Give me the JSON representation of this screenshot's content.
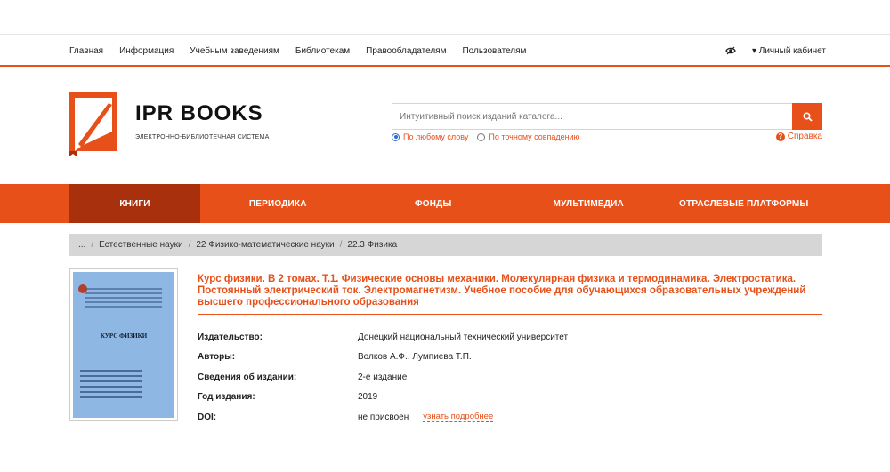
{
  "topnav": {
    "items": [
      "Главная",
      "Информация",
      "Учебным заведениям",
      "Библиотекам",
      "Правообладателям",
      "Пользователям"
    ],
    "account": "▾ Личный кабинет"
  },
  "brand": {
    "name": "IPR BOOKS",
    "tagline": "ЭЛЕКТРОННО-БИБЛИОТЕЧНАЯ СИСТЕМА"
  },
  "search": {
    "placeholder": "Интуитивный поиск изданий каталога...",
    "option_any": "По любому слову",
    "option_exact": "По точному совпадению",
    "help": "Справка"
  },
  "mainnav": [
    "КНИГИ",
    "ПЕРИОДИКА",
    "ФОНДЫ",
    "МУЛЬТИМЕДИА",
    "ОТРАСЛЕВЫЕ ПЛАТФОРМЫ"
  ],
  "breadcrumb": [
    "...",
    "Естественные науки",
    "22 Физико-математические науки",
    "22.3 Физика"
  ],
  "book": {
    "title": "Курс физики. В 2 томах. Т.1. Физические основы механики. Молекулярная физика и термодинамика. Электростатика. Постоянный электрический ток. Электромагнетизм. Учебное пособие для обучающихся образовательных учреждений высшего профессионального образования",
    "cover_title": "КУРС ФИЗИКИ",
    "fields": [
      {
        "label": "Издательство:",
        "value": "Донецкий национальный технический университет"
      },
      {
        "label": "Авторы:",
        "value": "Волков А.Ф., Лумпиева Т.П."
      },
      {
        "label": "Сведения об издании:",
        "value": "2-е издание"
      },
      {
        "label": "Год издания:",
        "value": "2019"
      },
      {
        "label": "DOI:",
        "value": "не присвоен"
      }
    ],
    "doi_link": "узнать подробнее"
  },
  "colors": {
    "accent": "#e8501a",
    "active_tab": "#a8300d",
    "breadcrumb_bg": "#d6d6d6",
    "cover": "#8fb7e4"
  }
}
